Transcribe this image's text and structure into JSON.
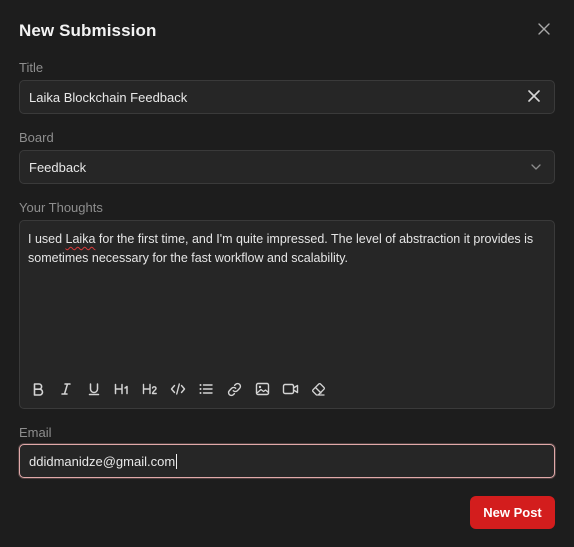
{
  "dialog": {
    "title": "New Submission",
    "close_icon": "close-icon"
  },
  "fields": {
    "title": {
      "label": "Title",
      "value": "Laika Blockchain Feedback",
      "clear_icon": "clear-x-icon"
    },
    "board": {
      "label": "Board",
      "selected": "Feedback",
      "chevron_icon": "chevron-down-icon"
    },
    "thoughts": {
      "label": "Your Thoughts",
      "text_before": "I used ",
      "misspelled": "Laika",
      "text_after": " for the first time, and I'm quite impressed. The level of abstraction it provides is sometimes necessary for the fast workflow and scalability."
    },
    "email": {
      "label": "Email",
      "value_misspelled": "ddidmanidze",
      "value_rest": "@gmail.com"
    }
  },
  "toolbar": {
    "buttons": [
      "bold-icon",
      "italic-icon",
      "underline-icon",
      "heading-1-icon",
      "heading-2-icon",
      "code-icon",
      "bullet-list-icon",
      "link-icon",
      "image-icon",
      "video-icon",
      "eraser-icon"
    ]
  },
  "actions": {
    "submit_label": "New Post"
  },
  "colors": {
    "primary": "#d31d1d",
    "background": "#1d1d1d",
    "field_bg": "#262626",
    "focus_border": "#e1a9a9"
  }
}
